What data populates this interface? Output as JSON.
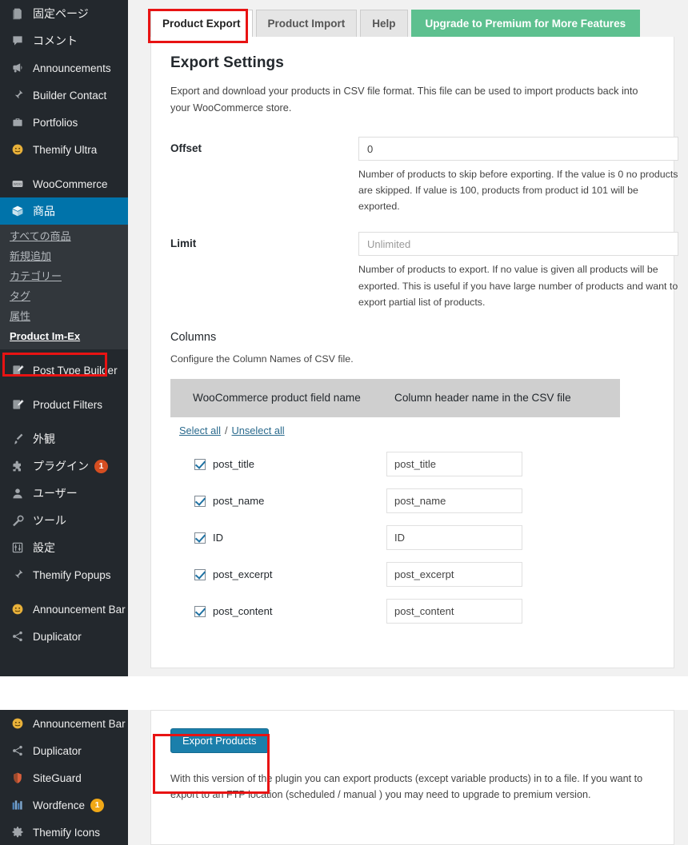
{
  "sidebar": {
    "items": [
      {
        "label": "固定ページ",
        "icon": "pages-icon",
        "jp": true
      },
      {
        "label": "コメント",
        "icon": "comments-icon",
        "jp": true
      },
      {
        "label": "Announcements",
        "icon": "megaphone-icon",
        "jp": false
      },
      {
        "label": "Builder Contact",
        "icon": "pin-icon",
        "jp": false
      },
      {
        "label": "Portfolios",
        "icon": "portfolio-icon",
        "jp": false
      },
      {
        "label": "Themify Ultra",
        "icon": "themify-face-icon",
        "jp": false
      },
      {
        "label": "WooCommerce",
        "icon": "woo-icon",
        "jp": false
      },
      {
        "label": "商品",
        "icon": "product-box-icon",
        "jp": true,
        "active": true
      },
      {
        "label": "Post Type Builder",
        "icon": "post-type-icon",
        "jp": false
      },
      {
        "label": "Product Filters",
        "icon": "filter-icon",
        "jp": false
      },
      {
        "label": "外観",
        "icon": "appearance-brush-icon",
        "jp": true
      },
      {
        "label": "プラグイン",
        "icon": "plugin-icon",
        "jp": true,
        "badge": "1",
        "badge_color": "red"
      },
      {
        "label": "ユーザー",
        "icon": "user-icon",
        "jp": true
      },
      {
        "label": "ツール",
        "icon": "tools-wrench-icon",
        "jp": true
      },
      {
        "label": "設定",
        "icon": "settings-sliders-icon",
        "jp": true
      },
      {
        "label": "Themify Popups",
        "icon": "pin-icon",
        "jp": false
      },
      {
        "label": "Announcement Bar",
        "icon": "themify-face-icon",
        "jp": false
      },
      {
        "label": "Duplicator",
        "icon": "share-icon",
        "jp": false
      }
    ],
    "product_submenu": [
      {
        "label": "すべての商品"
      },
      {
        "label": "新規追加"
      },
      {
        "label": "カテゴリー"
      },
      {
        "label": "タグ"
      },
      {
        "label": "属性"
      },
      {
        "label": "Product Im-Ex",
        "current": true
      }
    ],
    "bottom_items": [
      {
        "label": "Announcement Bar",
        "icon": "themify-face-icon"
      },
      {
        "label": "Duplicator",
        "icon": "share-icon"
      },
      {
        "label": "SiteGuard",
        "icon": "shield-icon"
      },
      {
        "label": "Wordfence",
        "icon": "wordfence-icon",
        "badge": "1",
        "badge_color": "yellow"
      },
      {
        "label": "Themify Icons",
        "icon": "gear-icon"
      }
    ]
  },
  "tabs": [
    {
      "label": "Product Export",
      "state": "active"
    },
    {
      "label": "Product Import",
      "state": "normal"
    },
    {
      "label": "Help",
      "state": "normal"
    },
    {
      "label": "Upgrade to Premium for More Features",
      "state": "upgrade"
    }
  ],
  "main": {
    "title": "Export Settings",
    "description": "Export and download your products in CSV file format. This file can be used to import products back into your WooCommerce store.",
    "offset": {
      "label": "Offset",
      "value": "0",
      "placeholder": "0",
      "help": "Number of products to skip before exporting. If the value is 0 no products are skipped. If value is 100, products from product id 101 will be exported."
    },
    "limit": {
      "label": "Limit",
      "value": "",
      "placeholder": "Unlimited",
      "help": "Number of products to export. If no value is given all products will be exported. This is useful if you have large number of products and want to export partial list of products."
    },
    "columns": {
      "title": "Columns",
      "description": "Configure the Column Names of CSV file.",
      "header_field": "WooCommerce product field name",
      "header_csv": "Column header name in the CSV file",
      "select_all": "Select all",
      "separator": "/",
      "unselect_all": "Unselect all",
      "rows": [
        {
          "field": "post_title",
          "csv_name": "post_title",
          "checked": true
        },
        {
          "field": "post_name",
          "csv_name": "post_name",
          "checked": true
        },
        {
          "field": "ID",
          "csv_name": "ID",
          "checked": true
        },
        {
          "field": "post_excerpt",
          "csv_name": "post_excerpt",
          "checked": true
        },
        {
          "field": "post_content",
          "csv_name": "post_content",
          "checked": true
        }
      ]
    }
  },
  "footer": {
    "export_button": "Export Products",
    "note": "With this version of the plugin you can export products (except variable products) in to a file. If you want to export to an FTP location (scheduled / manual ) you may need to upgrade to premium version."
  },
  "colors": {
    "sidebar_bg": "#23282d",
    "submenu_bg": "#32373c",
    "active_blue": "#0073aa",
    "upgrade_green": "#5dc08f",
    "export_button_blue": "#1b7fab",
    "annotation_red": "#e81313",
    "badge_red": "#d54e21",
    "badge_yellow": "#f0a817"
  }
}
